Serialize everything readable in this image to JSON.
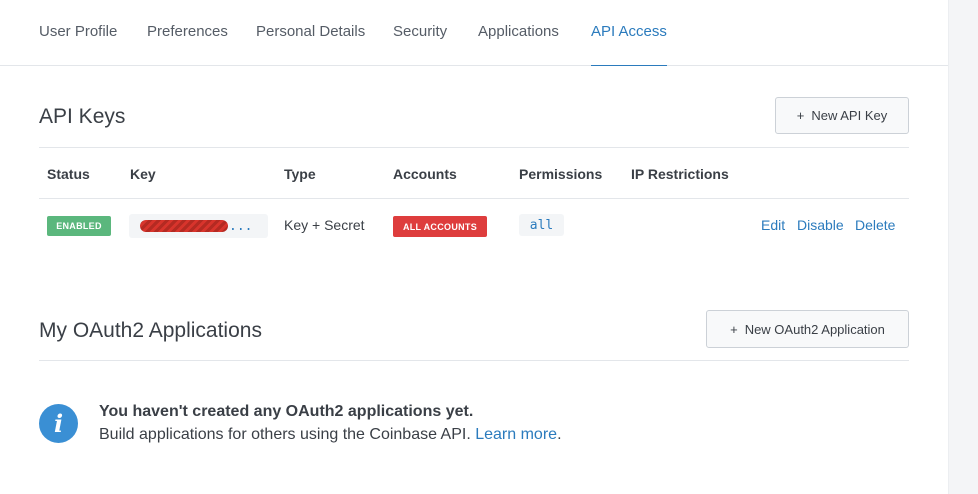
{
  "tabs": [
    {
      "label": "User Profile",
      "active": false
    },
    {
      "label": "Preferences",
      "active": false
    },
    {
      "label": "Personal Details",
      "active": false
    },
    {
      "label": "Security",
      "active": false
    },
    {
      "label": "Applications",
      "active": false
    },
    {
      "label": "API Access",
      "active": true
    }
  ],
  "api_keys": {
    "title": "API Keys",
    "new_button": {
      "icon": "+",
      "label": "New API Key"
    },
    "columns": [
      "Status",
      "Key",
      "Type",
      "Accounts",
      "Permissions",
      "IP Restrictions"
    ],
    "rows": [
      {
        "status": "ENABLED",
        "key_suffix": "...",
        "type": "Key + Secret",
        "accounts": "ALL ACCOUNTS",
        "permissions": "all",
        "ip_restrictions": "",
        "actions": [
          "Edit",
          "Disable",
          "Delete"
        ]
      }
    ]
  },
  "oauth": {
    "title": "My OAuth2 Applications",
    "new_button": {
      "icon": "+",
      "label": "New OAuth2 Application"
    },
    "empty_title": "You haven't created any OAuth2 applications yet.",
    "empty_desc": "Build applications for others using the Coinbase API.",
    "learn_more": "Learn more",
    "period": ".",
    "info_icon": "i"
  },
  "colors": {
    "accent": "#2b7bbd",
    "enabled_badge": "#5bb77d",
    "accounts_badge": "#de3d3d",
    "info_icon": "#3a8fd4"
  }
}
